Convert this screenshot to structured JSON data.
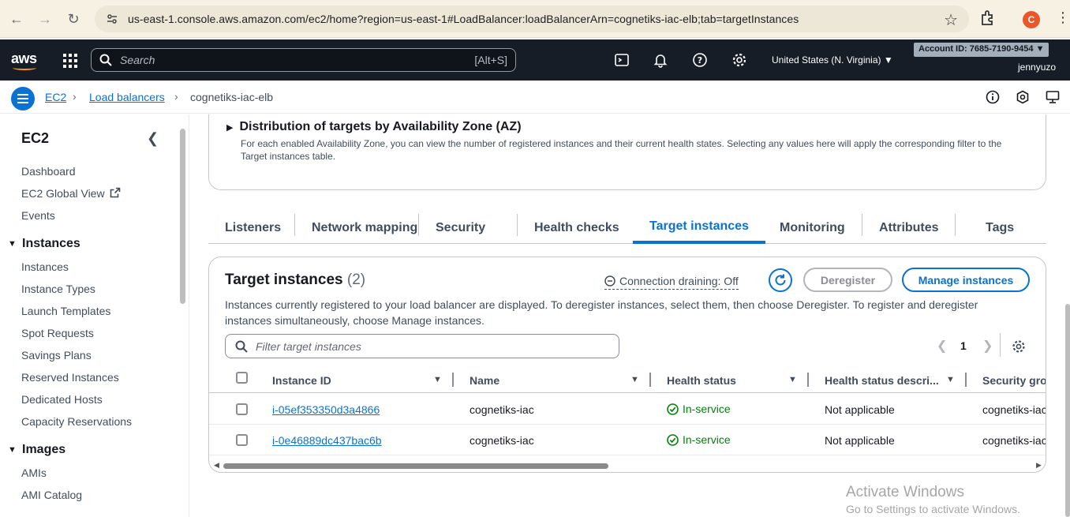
{
  "browser": {
    "url": "us-east-1.console.aws.amazon.com/ec2/home?region=us-east-1#LoadBalancer:loadBalancerArn=cognetiks-iac-elb;tab=targetInstances",
    "profile_initial": "C"
  },
  "aws_bar": {
    "logo": "aws",
    "search_placeholder": "Search",
    "search_shortcut": "[Alt+S]",
    "region": "United States (N. Virginia) ▼",
    "account": "Account ID: 7685-7190-9454 ▼",
    "user": "jennyuzo"
  },
  "breadcrumb": {
    "items": [
      "EC2",
      "Load balancers",
      "cognetiks-iac-elb"
    ]
  },
  "sidebar": {
    "title": "EC2",
    "top_items": [
      "Dashboard",
      "EC2 Global View",
      "Events"
    ],
    "sections": [
      {
        "title": "Instances",
        "items": [
          "Instances",
          "Instance Types",
          "Launch Templates",
          "Spot Requests",
          "Savings Plans",
          "Reserved Instances",
          "Dedicated Hosts",
          "Capacity Reservations"
        ]
      },
      {
        "title": "Images",
        "items": [
          "AMIs",
          "AMI Catalog"
        ]
      }
    ]
  },
  "az_section": {
    "title": "Distribution of targets by Availability Zone (AZ)",
    "description": "For each enabled Availability Zone, you can view the number of registered instances and their current health states. Selecting any values here will apply the corresponding filter to the Target instances table."
  },
  "tabs": [
    "Listeners",
    "Network mapping",
    "Security",
    "Health checks",
    "Target instances",
    "Monitoring",
    "Attributes",
    "Tags"
  ],
  "active_tab": "Target instances",
  "target_instances": {
    "title": "Target instances",
    "count": "(2)",
    "connection_draining": "Connection draining: Off",
    "deregister_label": "Deregister",
    "manage_label": "Manage instances",
    "description": "Instances currently registered to your load balancer are displayed. To deregister instances, select them, then choose Deregister. To register and deregister instances simultaneously, choose Manage instances.",
    "filter_placeholder": "Filter target instances",
    "page": "1",
    "columns": [
      "Instance ID",
      "Name",
      "Health status",
      "Health status descri...",
      "Security gro"
    ],
    "rows": [
      {
        "id": "i-05ef353350d3a4866",
        "name": "cognetiks-iac",
        "health": "In-service",
        "health_desc": "Not applicable",
        "sg": "cognetiks-iac"
      },
      {
        "id": "i-0e46889dc437bac6b",
        "name": "cognetiks-iac",
        "health": "In-service",
        "health_desc": "Not applicable",
        "sg": "cognetiks-iac"
      }
    ]
  },
  "watermark": {
    "line1": "Activate Windows",
    "line2": "Go to Settings to activate Windows."
  },
  "colors": {
    "accent": "#0972d3",
    "success": "#037f0c",
    "topbar": "#161d26"
  }
}
